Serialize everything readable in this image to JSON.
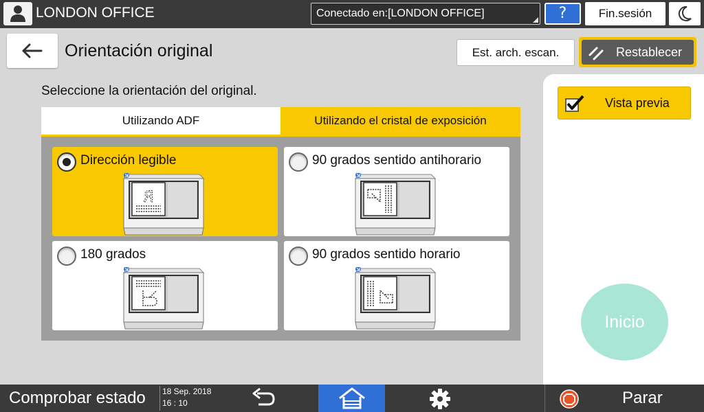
{
  "topbar": {
    "office_title": "LONDON OFFICE",
    "connection": "Conectado en:[LONDON OFFICE]",
    "help_label": "?",
    "logout_label": "Fin.sesión"
  },
  "header": {
    "title": "Orientación original",
    "scan_file_label": "Est. arch. escan.",
    "reset_label": "Restablecer"
  },
  "main": {
    "instruction": "Seleccione la orientación del original.",
    "tabs": [
      {
        "label": "Utilizando ADF",
        "active": false
      },
      {
        "label": "Utilizando el cristal de exposición",
        "active": true
      }
    ],
    "options": [
      {
        "label": "Dirección legible",
        "selected": true
      },
      {
        "label": "90 grados sentido antihorario",
        "selected": false
      },
      {
        "label": "180 grados",
        "selected": false
      },
      {
        "label": "90 grados sentido horario",
        "selected": false
      }
    ]
  },
  "side": {
    "preview_label": "Vista previa",
    "preview_checked": true,
    "start_label": "Inicio"
  },
  "bottombar": {
    "status_label": "Comprobar estado",
    "date": "18 Sep. 2018",
    "time": "16 : 10",
    "stop_label": "Parar"
  },
  "colors": {
    "accent_yellow": "#f8c800",
    "blue": "#2f6fd6",
    "start_disabled": "#a9e6d6"
  }
}
